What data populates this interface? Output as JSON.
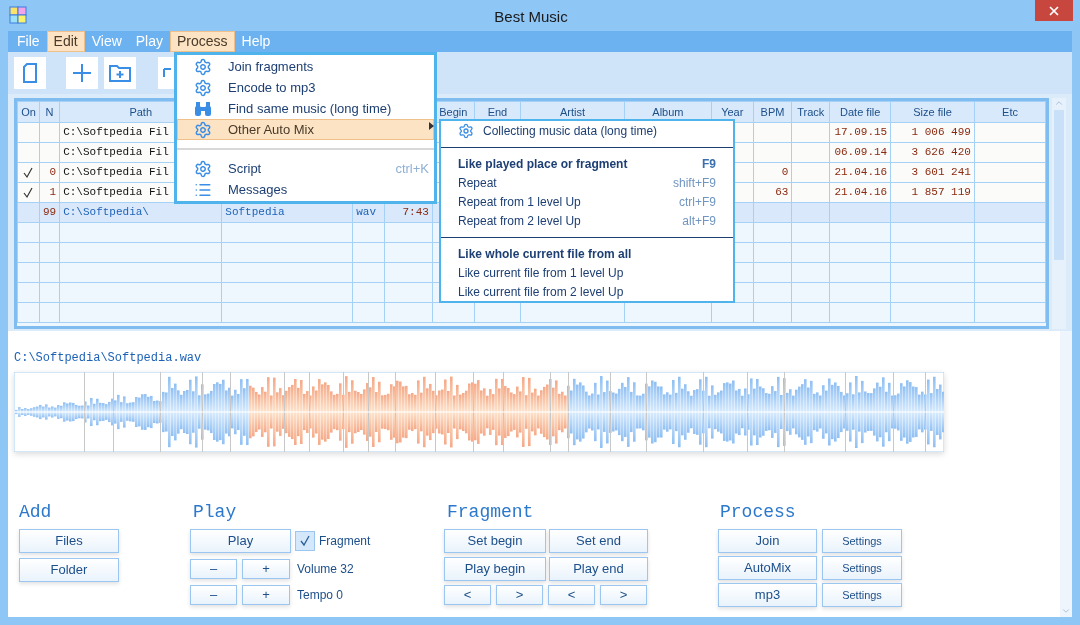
{
  "window": {
    "title": "Best Music"
  },
  "menu_bar": [
    {
      "label": "File",
      "highlighted": false
    },
    {
      "label": "Edit",
      "highlighted": true
    },
    {
      "label": "View",
      "highlighted": false
    },
    {
      "label": "Play",
      "highlighted": false
    },
    {
      "label": "Process",
      "highlighted": true
    },
    {
      "label": "Help",
      "highlighted": false
    }
  ],
  "process_menu": [
    {
      "kind": "item",
      "label": "Join fragments"
    },
    {
      "kind": "item",
      "label": "Encode to mp3"
    },
    {
      "kind": "item",
      "label": "Find same music (long time)"
    },
    {
      "kind": "submenu",
      "label": "Other Auto Mix",
      "highlighted": true
    },
    {
      "kind": "separator"
    },
    {
      "kind": "item",
      "label": "Script",
      "shortcut": "ctrl+K"
    },
    {
      "kind": "item",
      "label": "Messages"
    }
  ],
  "submenu": [
    {
      "kind": "item",
      "label": "Collecting music data  (long time)",
      "emphasis": false
    },
    {
      "kind": "separator"
    },
    {
      "kind": "item",
      "label": "Like played place or fragment",
      "shortcut": "F9",
      "emphasis": true
    },
    {
      "kind": "item",
      "label": "Repeat",
      "shortcut": "shift+F9",
      "emphasis": false
    },
    {
      "kind": "item",
      "label": "Repeat from 1 level Up",
      "shortcut": "ctrl+F9",
      "emphasis": false
    },
    {
      "kind": "item",
      "label": "Repeat from 2 level Up",
      "shortcut": "alt+F9",
      "emphasis": false
    },
    {
      "kind": "separator"
    },
    {
      "kind": "item",
      "label": "Like whole current file from all",
      "emphasis": true
    },
    {
      "kind": "item",
      "label": "Like current file from 1 level Up",
      "emphasis": false
    },
    {
      "kind": "item",
      "label": "Like current file from 2 level Up",
      "emphasis": false
    }
  ],
  "table": {
    "columns": [
      "On",
      "N",
      "Path",
      null,
      null,
      null,
      "Begin",
      "End",
      "Artist",
      "Album",
      "Year",
      "BPM",
      "Track",
      "Date file",
      "Size file",
      "Etc"
    ],
    "rows": [
      {
        "checked": false,
        "selected": false,
        "cells": [
          null,
          null,
          "C:\\Softpedia Fil",
          null,
          null,
          null,
          null,
          null,
          null,
          null,
          null,
          null,
          null,
          "17.09.15",
          "1 006 499",
          null
        ]
      },
      {
        "checked": false,
        "selected": false,
        "cells": [
          null,
          null,
          "C:\\Softpedia Fil",
          null,
          null,
          null,
          null,
          null,
          null,
          null,
          null,
          null,
          null,
          "06.09.14",
          "3 626 420",
          null
        ]
      },
      {
        "checked": true,
        "selected": false,
        "cells": [
          null,
          "0",
          "C:\\Softpedia Fil",
          null,
          null,
          null,
          null,
          null,
          null,
          null,
          null,
          "0",
          null,
          "21.04.16",
          "3 601 241",
          null
        ]
      },
      {
        "checked": true,
        "selected": false,
        "cells": [
          null,
          "1",
          "C:\\Softpedia Fil",
          null,
          null,
          null,
          null,
          null,
          null,
          null,
          null,
          "63",
          null,
          "21.04.16",
          "1 857 119",
          null
        ]
      },
      {
        "checked": false,
        "selected": true,
        "cells": [
          null,
          "99",
          "C:\\Softpedia\\",
          "Softpedia",
          "wav",
          "7:43",
          null,
          null,
          null,
          null,
          null,
          null,
          null,
          null,
          null,
          null
        ]
      }
    ]
  },
  "waveform": {
    "path": "C:\\Softpedia\\Softpedia.wav"
  },
  "add": {
    "title": "Add",
    "buttons": [
      "Files",
      "Folder"
    ]
  },
  "play": {
    "title": "Play",
    "play_button": "Play",
    "fragment": {
      "label": "Fragment",
      "checked": true
    },
    "steppers": [
      {
        "minus": "–",
        "plus": "+",
        "label": "Volume 32"
      },
      {
        "minus": "–",
        "plus": "+",
        "label": "Tempo 0"
      }
    ]
  },
  "fragment": {
    "title": "Fragment",
    "rows": [
      [
        "Set begin",
        "Set end"
      ],
      [
        "Play begin",
        "Play end"
      ]
    ],
    "arrows": [
      "<",
      ">",
      "<",
      ">"
    ]
  },
  "process": {
    "title": "Process",
    "rows": [
      {
        "action": "Join",
        "settings": "Settings"
      },
      {
        "action": "AutoMix",
        "settings": "Settings"
      },
      {
        "action": "mp3",
        "settings": "Settings"
      }
    ]
  }
}
